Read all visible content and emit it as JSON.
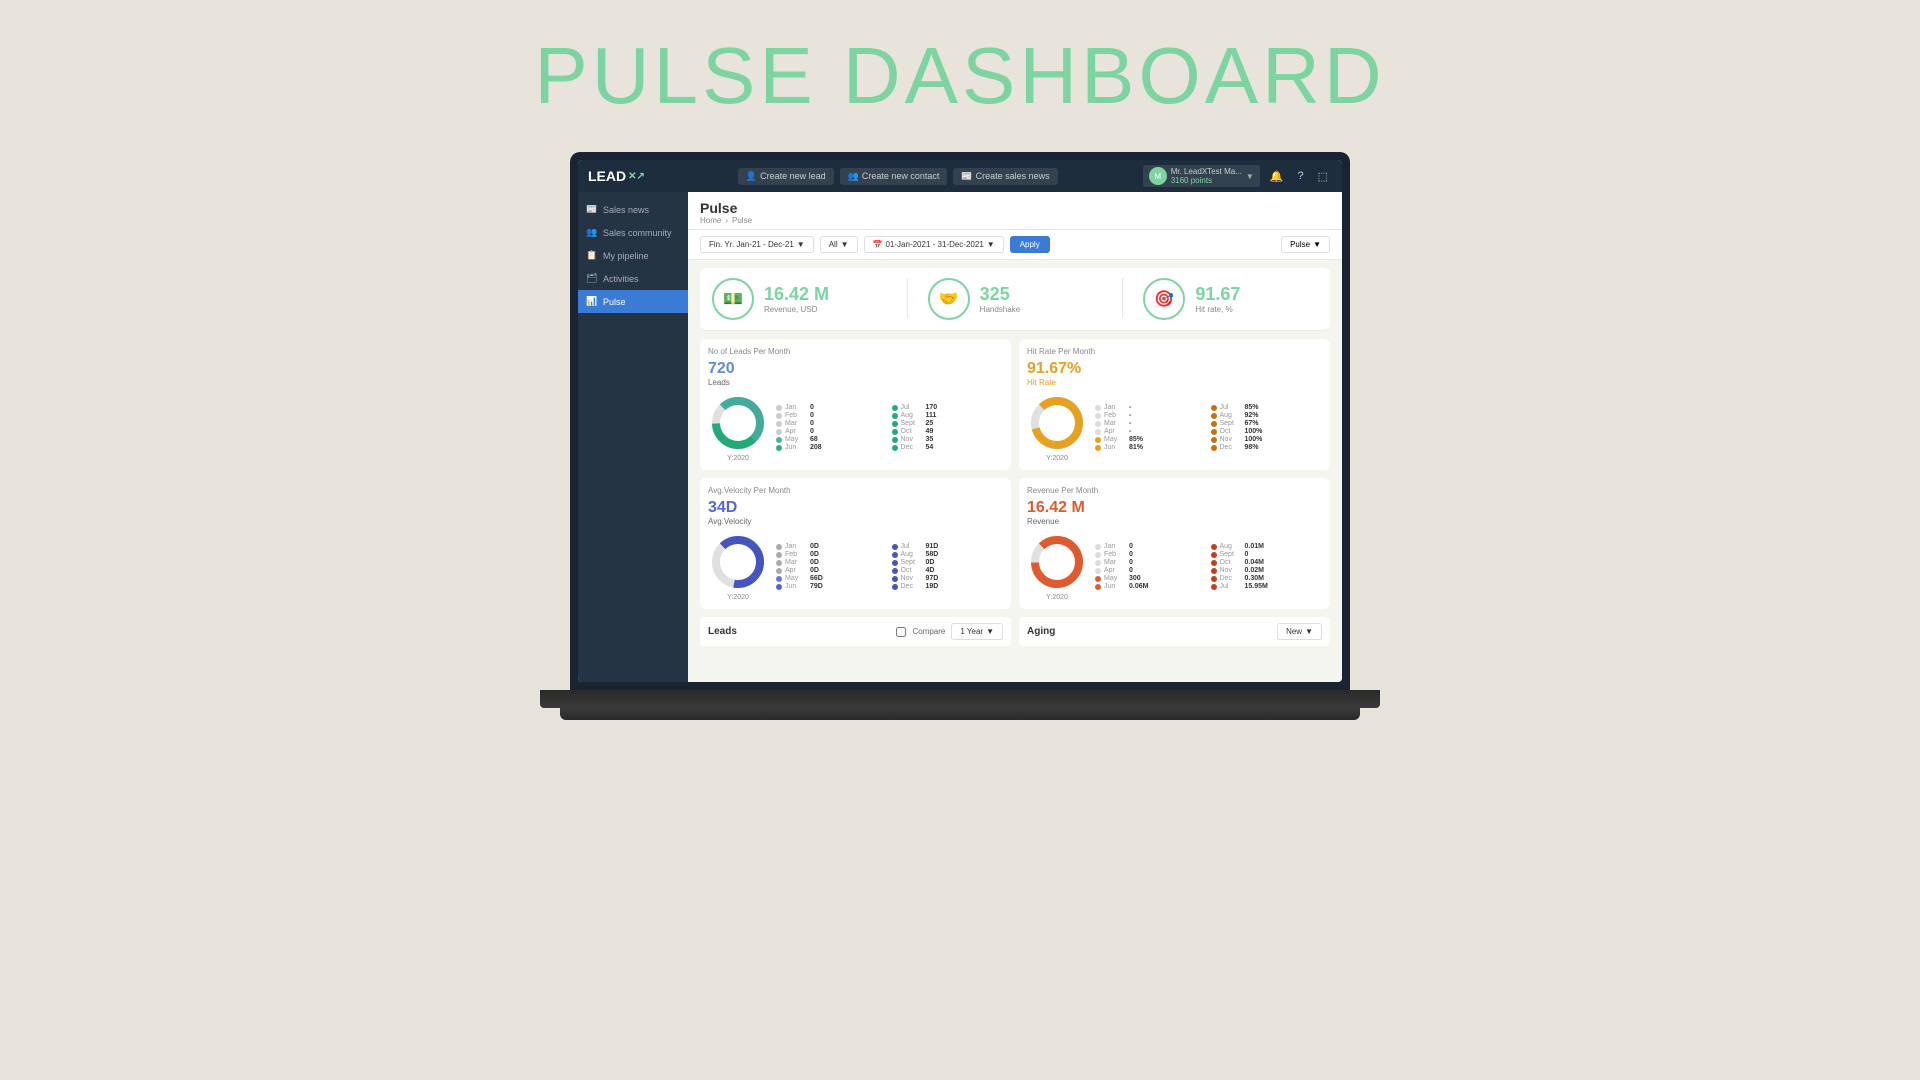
{
  "page": {
    "title": "PULSE DASHBOARD"
  },
  "topbar": {
    "logo": "LEAD",
    "logo_symbol": "✕↗",
    "btn_new_lead": "Create new lead",
    "btn_new_contact": "Create new contact",
    "btn_sales_news": "Create sales news",
    "user_name": "Mr. LeadXTest Ma...",
    "user_points": "3160 points",
    "icon_bell": "🔔",
    "icon_help": "?",
    "icon_exit": "⬚"
  },
  "sidebar": {
    "items": [
      {
        "label": "Sales news",
        "icon": "📰",
        "active": false
      },
      {
        "label": "Sales community",
        "icon": "👥",
        "active": false
      },
      {
        "label": "My pipeline",
        "icon": "📋",
        "active": false
      },
      {
        "label": "Activities",
        "icon": "🗂",
        "active": false
      },
      {
        "label": "Pulse",
        "icon": "📊",
        "active": true
      }
    ]
  },
  "content": {
    "title": "Pulse",
    "breadcrumb_home": "Home",
    "breadcrumb_sep": "›",
    "breadcrumb_current": "Pulse",
    "filter_fy": "Fin. Yr. Jan-21 - Dec-21",
    "filter_all": "All",
    "filter_date": "01-Jan-2021 - 31-Dec-2021",
    "btn_apply": "Apply",
    "btn_pulse": "Pulse"
  },
  "metrics": {
    "revenue": {
      "value": "16.42 M",
      "label": "Revenue, USD",
      "icon": "💵"
    },
    "handshake": {
      "value": "325",
      "label": "Handshake",
      "icon": "🤝"
    },
    "hitrate": {
      "value": "91.67",
      "label": "Hit rate, %",
      "icon": "🎯"
    }
  },
  "chart_leads": {
    "stat": "720",
    "stat_label": "Leads",
    "donut_year": "Y:2020",
    "legend": [
      {
        "month": "Jan",
        "val": "0",
        "color": "#aaa"
      },
      {
        "month": "Feb",
        "val": "0",
        "color": "#aaa"
      },
      {
        "month": "Mar",
        "val": "0",
        "color": "#aaa"
      },
      {
        "month": "Apr",
        "val": "0",
        "color": "#aaa"
      },
      {
        "month": "May",
        "val": "68",
        "color": "#5b8"
      },
      {
        "month": "Jun",
        "val": "208",
        "color": "#3a7"
      },
      {
        "month": "Jul",
        "val": "170",
        "color": "#2a6"
      },
      {
        "month": "Aug",
        "val": "111",
        "color": "#2a6"
      },
      {
        "month": "Sept",
        "val": "25",
        "color": "#2a6"
      },
      {
        "month": "Oct",
        "val": "49",
        "color": "#2a6"
      },
      {
        "month": "Nov",
        "val": "35",
        "color": "#2a6"
      },
      {
        "month": "Dec",
        "val": "54",
        "color": "#2a6"
      }
    ],
    "chart_title": "No of Leads Per Month"
  },
  "chart_hitrate": {
    "stat": "91.67%",
    "stat_label": "Hit Rate",
    "donut_year": "Y:2020",
    "legend": [
      {
        "month": "Jan",
        "val": "-",
        "color": "#ddd"
      },
      {
        "month": "Feb",
        "val": "-",
        "color": "#ddd"
      },
      {
        "month": "Mar",
        "val": "-",
        "color": "#ddd"
      },
      {
        "month": "Apr",
        "val": "-",
        "color": "#ddd"
      },
      {
        "month": "May",
        "val": "85%",
        "color": "#e8a020"
      },
      {
        "month": "Jun",
        "val": "81%",
        "color": "#e8a020"
      },
      {
        "month": "Jul",
        "val": "85%",
        "color": "#c87010"
      },
      {
        "month": "Aug",
        "val": "92%",
        "color": "#c87010"
      },
      {
        "month": "Sept",
        "val": "67%",
        "color": "#c87010"
      },
      {
        "month": "Oct",
        "val": "100%",
        "color": "#c87010"
      },
      {
        "month": "Nov",
        "val": "100%",
        "color": "#c87010"
      },
      {
        "month": "Dec",
        "val": "98%",
        "color": "#c87010"
      }
    ],
    "chart_title": "Hit Rate Per Month"
  },
  "chart_velocity": {
    "stat": "34D",
    "stat_label": "Avg.Velocity",
    "donut_year": "Y:2020",
    "legend": [
      {
        "month": "Jan",
        "val": "0D",
        "color": "#aaa"
      },
      {
        "month": "Feb",
        "val": "0D",
        "color": "#aaa"
      },
      {
        "month": "Mar",
        "val": "0D",
        "color": "#aaa"
      },
      {
        "month": "Apr",
        "val": "0D",
        "color": "#aaa"
      },
      {
        "month": "May",
        "val": "66D",
        "color": "#6677dd"
      },
      {
        "month": "Jun",
        "val": "79D",
        "color": "#5566cc"
      },
      {
        "month": "Jul",
        "val": "91D",
        "color": "#4455bb"
      },
      {
        "month": "Aug",
        "val": "58D",
        "color": "#4455bb"
      },
      {
        "month": "Sept",
        "val": "0D",
        "color": "#4455bb"
      },
      {
        "month": "Oct",
        "val": "4D",
        "color": "#4455bb"
      },
      {
        "month": "Nov",
        "val": "97D",
        "color": "#4455bb"
      },
      {
        "month": "Dec",
        "val": "19D",
        "color": "#4455bb"
      }
    ],
    "chart_title": "Avg.Velocity Per Month"
  },
  "chart_revenue": {
    "stat": "16.42 M",
    "stat_label": "Revenue",
    "donut_year": "Y:2020",
    "legend": [
      {
        "month": "Jan",
        "val": "0",
        "color": "#ddd"
      },
      {
        "month": "Feb",
        "val": "0",
        "color": "#ddd"
      },
      {
        "month": "Mar",
        "val": "0",
        "color": "#ddd"
      },
      {
        "month": "Apr",
        "val": "0",
        "color": "#ddd"
      },
      {
        "month": "May",
        "val": "300",
        "color": "#e05a30"
      },
      {
        "month": "Jun",
        "val": "0.06 M",
        "color": "#e05a30"
      },
      {
        "month": "Jul",
        "val": "15.95 M",
        "color": "#c04020"
      },
      {
        "month": "Aug",
        "val": "0.01 M",
        "color": "#c04020"
      },
      {
        "month": "Sept",
        "val": "0",
        "color": "#c04020"
      },
      {
        "month": "Oct",
        "val": "0.04 M",
        "color": "#c04020"
      },
      {
        "month": "Nov",
        "val": "0.02 M",
        "color": "#c04020"
      },
      {
        "month": "Dec",
        "val": "0.30 M",
        "color": "#c04020"
      }
    ],
    "chart_title": "Revenue Per Month"
  },
  "bottom": {
    "leads_label": "Leads",
    "compare_label": "Compare",
    "period_label": "1 Year",
    "aging_label": "Aging",
    "new_label": "New"
  }
}
